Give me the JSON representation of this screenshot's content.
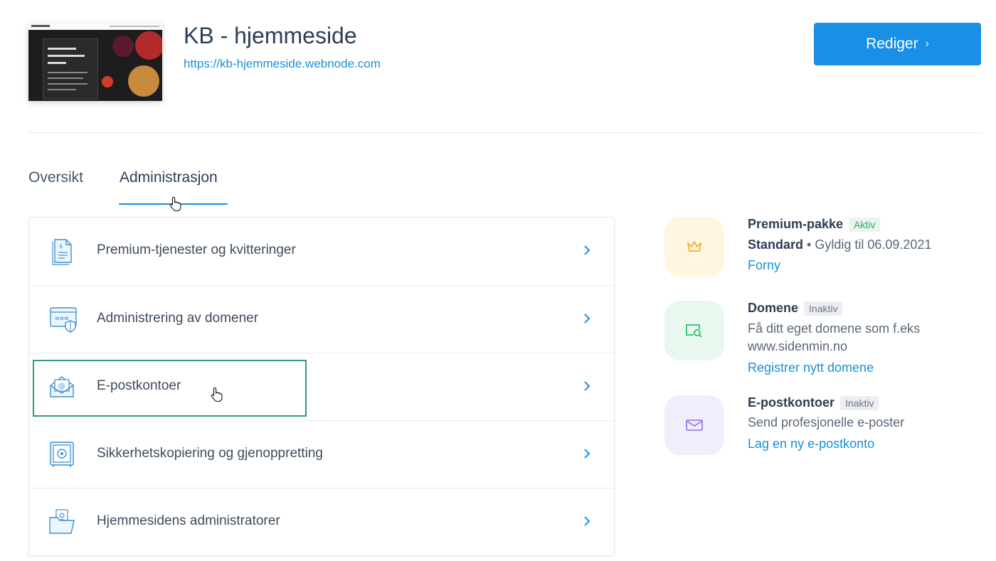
{
  "site": {
    "title": "KB - hjemmeside",
    "url": "https://kb-hjemmeside.webnode.com",
    "thumbnail_lines": [
      "100% NATURLIG",
      "MARMELADE",
      "& GELÉ"
    ]
  },
  "header": {
    "edit_label": "Rediger",
    "edit_chevron": "›"
  },
  "tabs": [
    {
      "label": "Oversikt",
      "selected": false
    },
    {
      "label": "Administrasjon",
      "selected": true
    }
  ],
  "menu": {
    "items": [
      {
        "label": "Premium-tjenester og kvitteringer",
        "icon": "receipt-icon"
      },
      {
        "label": "Administrering av domener",
        "icon": "www-shield-icon"
      },
      {
        "label": "E-postkontoer",
        "icon": "email-envelope-icon",
        "highlighted": true
      },
      {
        "label": "Sikkerhetskopiering og gjenoppretting",
        "icon": "safe-icon"
      },
      {
        "label": "Hjemmesidens administratorer",
        "icon": "admin-folder-icon"
      }
    ]
  },
  "status": {
    "premium": {
      "title": "Premium-pakke",
      "badge": "Aktiv",
      "plan": "Standard",
      "separator": " • ",
      "validity": "Gyldig til 06.09.2021",
      "link": "Forny"
    },
    "domain": {
      "title": "Domene",
      "badge": "Inaktiv",
      "description_1": "Få ditt eget domene som f.eks",
      "description_2": "www.sidenmin.no",
      "link": "Registrer nytt domene"
    },
    "email": {
      "title": "E-postkontoer",
      "badge": "Inaktiv",
      "description": "Send profesjonelle e-poster",
      "link": "Lag en ny e-postkonto"
    }
  },
  "colors": {
    "accent": "#1a8fe8",
    "link": "#1a8fd8",
    "highlight_border": "#2f9e6e",
    "premium_bg": "#fff6e0",
    "domain_bg": "#e8f8ee",
    "email_bg": "#f0edfc"
  }
}
